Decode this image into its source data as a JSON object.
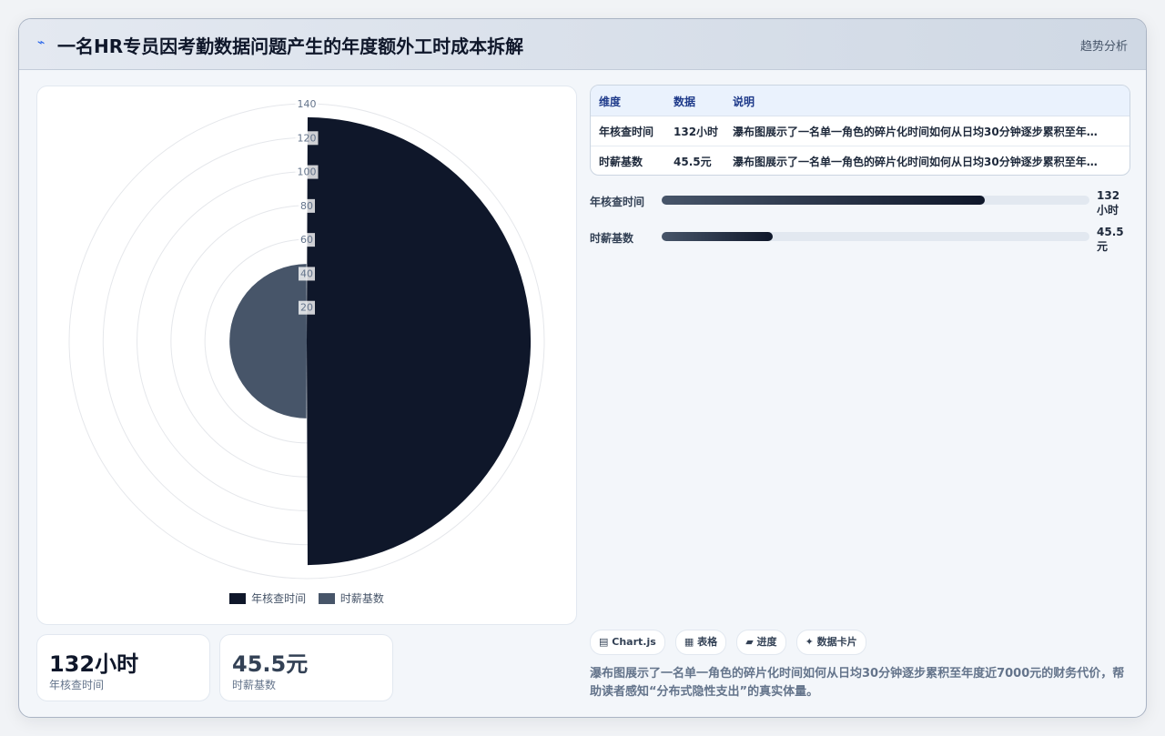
{
  "header": {
    "icon": "bolt-icon",
    "title": "一名HR专员因考勤数据问题产生的年度额外工时成本拆解",
    "action_label": "趋势分析"
  },
  "chart_data": {
    "type": "polar-area",
    "categories": [
      "年核查时间",
      "时薪基数"
    ],
    "values": [
      132,
      45.5
    ],
    "colors": [
      "#0f172a",
      "#475569"
    ],
    "rticks": [
      0,
      20,
      40,
      60,
      80,
      100,
      120,
      140
    ],
    "rlim": [
      0,
      140
    ],
    "legend_position": "bottom"
  },
  "stats": [
    {
      "value": "132小时",
      "label": "年核查时间",
      "color": "#0f172a"
    },
    {
      "value": "45.5元",
      "label": "时薪基数",
      "color": "#334155"
    }
  ],
  "table": {
    "headers": [
      "维度",
      "数据",
      "说明"
    ],
    "rows": [
      [
        "年核查时间",
        "132小时",
        "瀑布图展示了一名单一角色的碎片化时间如何从日均30分钟逐步累积至年度近7000元的财务代价，帮助读者感知“分布式隐性支出”的真实体量。"
      ],
      [
        "时薪基数",
        "45.5元",
        "瀑布图展示了一名单一角色的碎片化时间如何从日均30分钟逐步累积至年度近7000元的财务代价，帮助读者感知“分布式隐性支出”的真实体量。"
      ]
    ]
  },
  "progress": [
    {
      "label": "年核查时间",
      "value_text": "132小时",
      "fraction": 0.755
    },
    {
      "label": "时薪基数",
      "value_text": "45.5元",
      "fraction": 0.26
    }
  ],
  "tags": [
    {
      "icon": "chart-icon",
      "glyph": "▤",
      "label": "Chart.js"
    },
    {
      "icon": "table-icon",
      "glyph": "▦",
      "label": "表格"
    },
    {
      "icon": "progress-icon",
      "glyph": "▰",
      "label": "进度"
    },
    {
      "icon": "card-icon",
      "glyph": "✦",
      "label": "数据卡片"
    }
  ],
  "note": "瀑布图展示了一名单一角色的碎片化时间如何从日均30分钟逐步累积至年度近7000元的财务代价，帮助读者感知“分布式隐性支出”的真实体量。"
}
